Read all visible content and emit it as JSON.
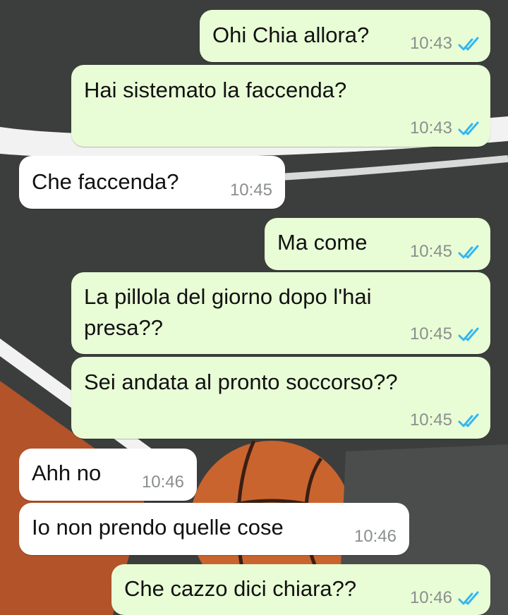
{
  "colors": {
    "outgoing_bubble": "#e8fdd6",
    "incoming_bubble": "#ffffff",
    "read_ticks": "#34b7f1",
    "timestamp": "#8a8f8c"
  },
  "messages": [
    {
      "direction": "outgoing",
      "text": "Ohi Chia allora?",
      "time": "10:43",
      "status": "read-ticks-icon"
    },
    {
      "direction": "outgoing",
      "text": "Hai sistemato la faccenda?",
      "time": "10:43",
      "status": "read-ticks-icon"
    },
    {
      "direction": "incoming",
      "text": "Che faccenda?",
      "time": "10:45"
    },
    {
      "direction": "outgoing",
      "text": "Ma come",
      "time": "10:45",
      "status": "read-ticks-icon"
    },
    {
      "direction": "outgoing",
      "text_line1": "La pillola del giorno dopo l'hai",
      "text_line2": "presa??",
      "time": "10:45",
      "status": "read-ticks-icon"
    },
    {
      "direction": "outgoing",
      "text": "Sei andata al pronto soccorso??",
      "time": "10:45",
      "status": "read-ticks-icon"
    },
    {
      "direction": "incoming",
      "text": "Ahh no",
      "time": "10:46"
    },
    {
      "direction": "incoming",
      "text": "Io non prendo quelle cose",
      "time": "10:46"
    },
    {
      "direction": "outgoing",
      "text": "Che cazzo dici chiara??",
      "time": "10:46",
      "status": "read-ticks-icon"
    }
  ]
}
